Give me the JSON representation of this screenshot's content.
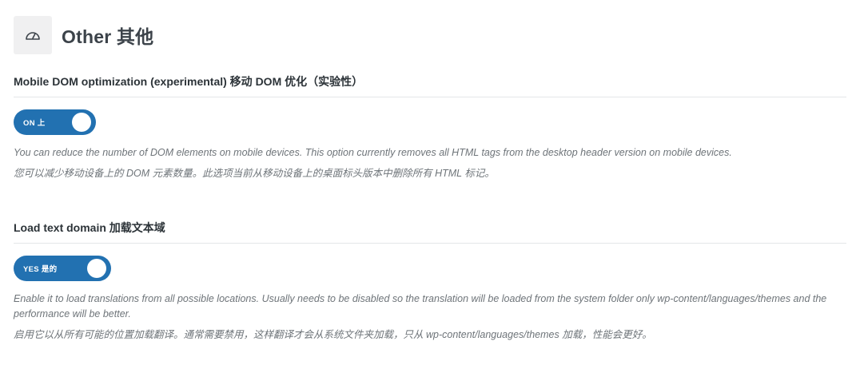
{
  "header": {
    "icon": "dashboard-gauge-icon",
    "title": "Other  其他"
  },
  "sections": [
    {
      "title": "Mobile DOM optimization (experimental)  移动 DOM 优化（实验性）",
      "toggle_label": "ON  上",
      "toggle_state": "on",
      "description_en": "You can reduce the number of DOM elements on mobile devices. This option currently removes all HTML tags from the desktop header version on mobile devices.",
      "description_zh": "您可以减少移动设备上的 DOM 元素数量。此选项当前从移动设备上的桌面标头版本中删除所有 HTML 标记。"
    },
    {
      "title": "Load text domain  加载文本域",
      "toggle_label": "YES  是的",
      "toggle_state": "on",
      "description_en": "Enable it to load translations from all possible locations. Usually needs to be disabled so the translation will be loaded from the system folder only wp-content/languages/themes and the performance will be better.",
      "description_zh": "启用它以从所有可能的位置加载翻译。通常需要禁用，这样翻译才会从系统文件夹加载，只从 wp-content/languages/themes 加载，性能会更好。"
    }
  ],
  "colors": {
    "toggle_on": "#2271b1",
    "header_icon_bg": "#f0f0f1",
    "description_text": "#6e7479"
  }
}
